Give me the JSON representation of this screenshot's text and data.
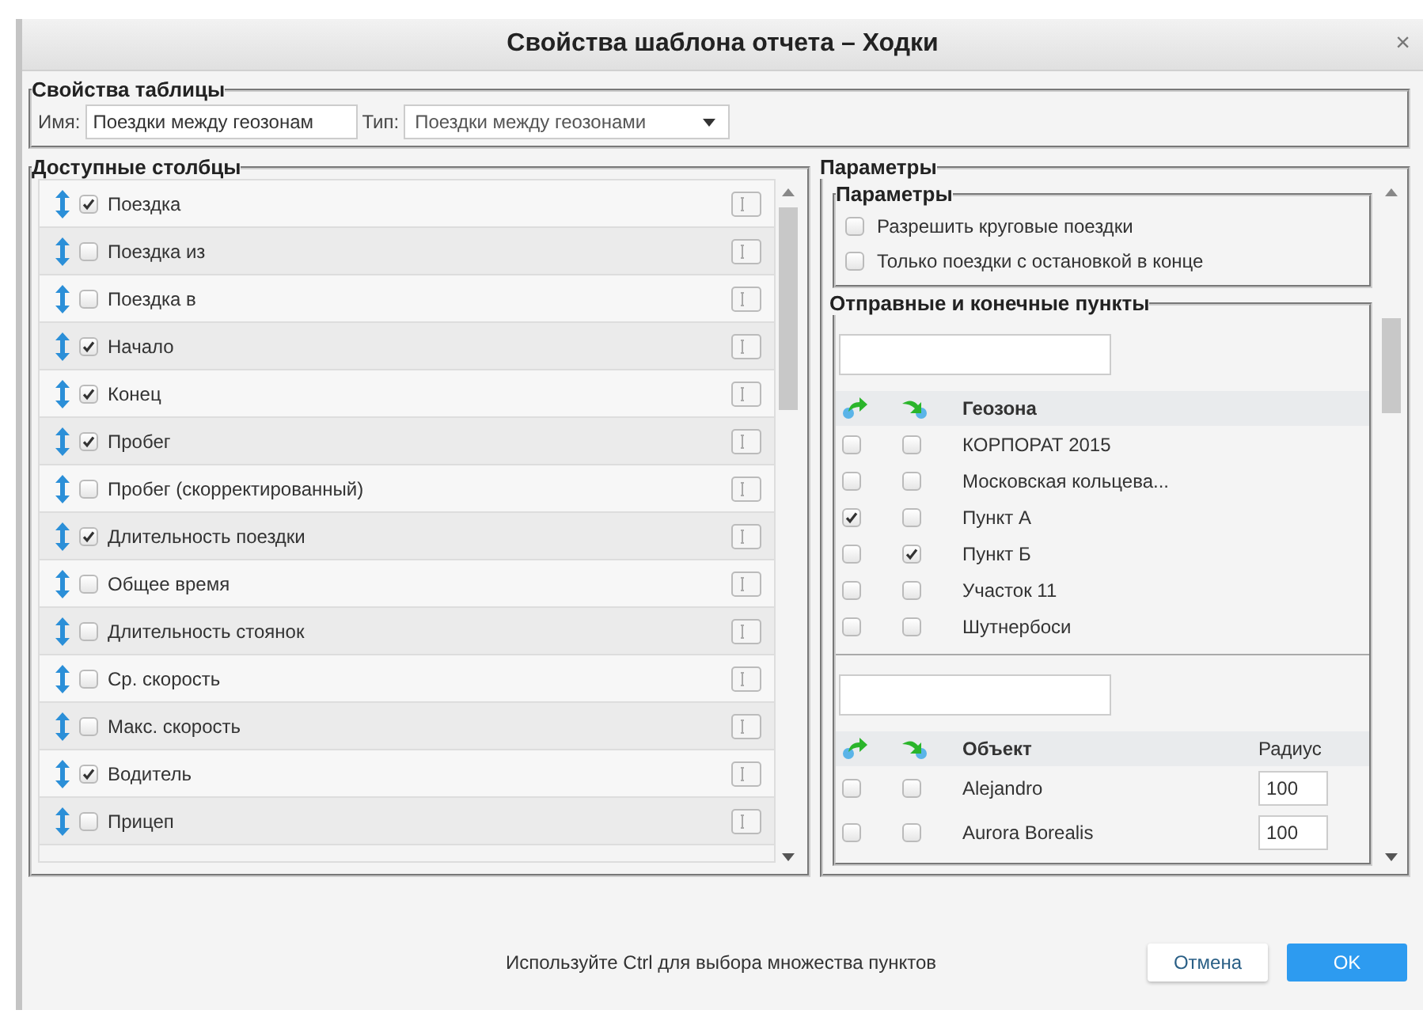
{
  "dialog": {
    "title": "Свойства шаблона отчета – Ходки",
    "close": "×"
  },
  "table_properties": {
    "legend": "Свойства таблицы",
    "name_label": "Имя:",
    "name_value": "Поездки между геозонам",
    "type_label": "Тип:",
    "type_value": "Поездки между геозонами"
  },
  "columns": {
    "legend": "Доступные столбцы",
    "items": [
      {
        "label": "Поездка",
        "checked": true
      },
      {
        "label": "Поездка из",
        "checked": false
      },
      {
        "label": "Поездка в",
        "checked": false
      },
      {
        "label": "Начало",
        "checked": true
      },
      {
        "label": "Конец",
        "checked": true
      },
      {
        "label": "Пробег",
        "checked": true
      },
      {
        "label": "Пробег (скорректированный)",
        "checked": false
      },
      {
        "label": "Длительность поездки",
        "checked": true
      },
      {
        "label": "Общее время",
        "checked": false
      },
      {
        "label": "Длительность стоянок",
        "checked": false
      },
      {
        "label": "Ср. скорость",
        "checked": false
      },
      {
        "label": "Макс. скорость",
        "checked": false
      },
      {
        "label": "Водитель",
        "checked": true
      },
      {
        "label": "Прицеп",
        "checked": false
      }
    ]
  },
  "parameters": {
    "legend": "Параметры",
    "options_legend": "Параметры",
    "options": [
      {
        "label": "Разрешить круговые поездки",
        "checked": false
      },
      {
        "label": "Только поездки с остановкой в конце",
        "checked": false
      }
    ],
    "points_legend": "Отправные и конечные пункты",
    "geozones": {
      "column": "Геозона",
      "rows": [
        {
          "name": "КОРПОРАТ 2015",
          "from": false,
          "to": false
        },
        {
          "name": "Московская кольцева...",
          "from": false,
          "to": false
        },
        {
          "name": "Пункт А",
          "from": true,
          "to": false
        },
        {
          "name": "Пункт Б",
          "from": false,
          "to": true
        },
        {
          "name": "Участок 11",
          "from": false,
          "to": false
        },
        {
          "name": "Шутнербоси",
          "from": false,
          "to": false
        }
      ]
    },
    "units": {
      "column": "Объект",
      "radius_column": "Радиус",
      "rows": [
        {
          "name": "Alejandro",
          "radius": "100",
          "from": false,
          "to": false
        },
        {
          "name": "Aurora Borealis",
          "radius": "100",
          "from": false,
          "to": false
        }
      ]
    }
  },
  "footer": {
    "hint": "Используйте Ctrl для выбора множества пунктов",
    "buttons": [
      {
        "label": "Отмена",
        "kind": "secondary"
      },
      {
        "label": "OK",
        "kind": "primary"
      }
    ]
  }
}
